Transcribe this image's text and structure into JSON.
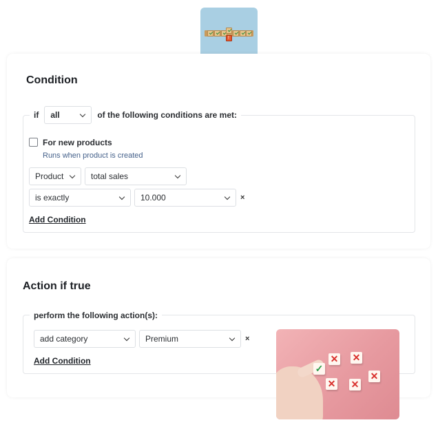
{
  "condition_card": {
    "title": "Condition",
    "legend": {
      "prefix": "if",
      "match_select": "all",
      "suffix": "of the following conditions are met:"
    },
    "new_products": {
      "label": "For new products",
      "hint": "Runs when product is created",
      "checked": false
    },
    "rule": {
      "entity_select": "Product",
      "field_select": "total sales",
      "operator_select": "is exactly",
      "value_select": "10.000",
      "remove_glyph": "×"
    },
    "add_condition": "Add Condition"
  },
  "action_card": {
    "title": "Action if true",
    "legend": "perform the following action(s):",
    "action": {
      "type_select": "add category",
      "value_select": "Premium",
      "remove_glyph": "×"
    },
    "add_condition": "Add Condition"
  },
  "images": {
    "top_thumbnail": "checkmark-blocks-photo",
    "bottom_photo": "hand-picking-check-cube-photo"
  },
  "colors": {
    "card_border": "#e3e5e8",
    "text": "#1f2328",
    "hint": "#44608a"
  }
}
